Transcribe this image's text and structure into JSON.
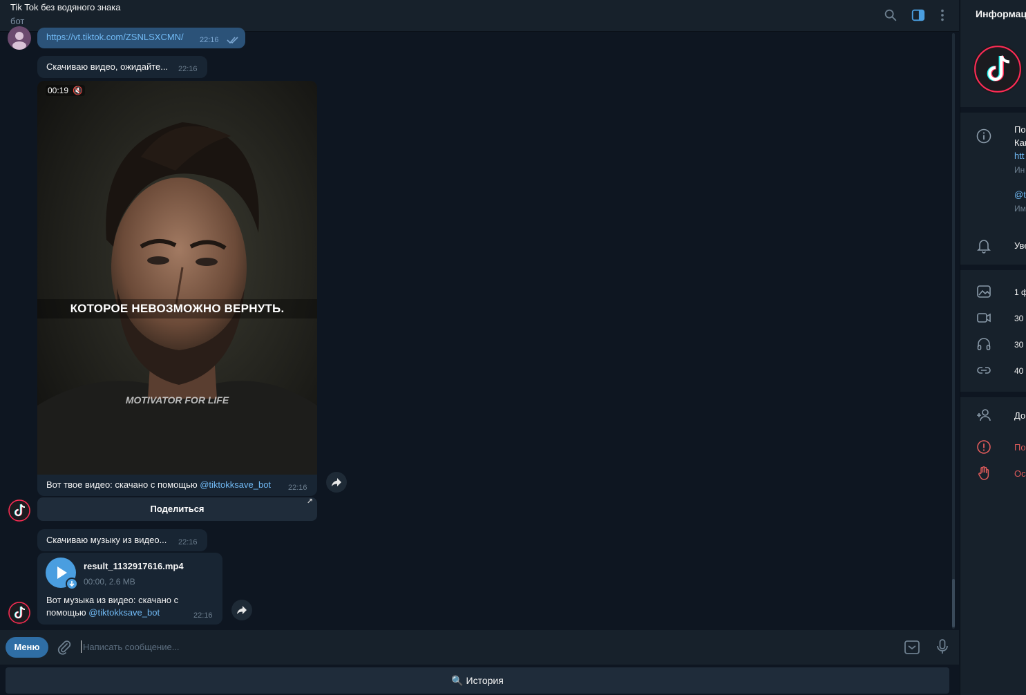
{
  "header": {
    "title": "Tik Tok без водяного знака",
    "subtitle": "бот"
  },
  "messages": {
    "link_msg": {
      "text": "https://vt.tiktok.com/ZSNLSXCMN/",
      "time": "22:16"
    },
    "downloading_video": {
      "text": "Скачиваю видео, ожидайте...",
      "time": "22:16"
    },
    "video": {
      "duration": "00:19",
      "caption_overlay": "КОТОРОЕ НЕВОЗМОЖНО ВЕРНУТЬ.",
      "watermark": "MOTIVATOR FOR LIFE",
      "text_prefix": "Вот твое видео: скачано с помощью ",
      "mention": "@tiktokksave_bot",
      "time": "22:16",
      "share_label": "Поделиться"
    },
    "downloading_music": {
      "text": "Скачиваю музыку из видео...",
      "time": "22:16"
    },
    "audio": {
      "file_name": "result_1132917616.mp4",
      "meta": "00:00, 2.6 MB",
      "line1": "Вот музыка из видео: скачано с",
      "line2_prefix": "помощью ",
      "mention": "@tiktokksave_bot",
      "time": "22:16"
    }
  },
  "composer": {
    "menu_label": "Меню",
    "placeholder": "Написать сообщение..."
  },
  "keyboard": {
    "history_label": "🔍 История"
  },
  "info_panel": {
    "title": "Информац",
    "about_lines": [
      "По",
      "Как",
      "htt",
      "Ин"
    ],
    "username_lines": [
      "@t",
      "Им"
    ],
    "notifications": "Уве",
    "media_counts": [
      "1 ф",
      "30",
      "30",
      "40"
    ],
    "add_label": "До",
    "report_label": "По",
    "stop_label": "Ос"
  },
  "colors": {
    "background": "#0e1621",
    "panel": "#17212b",
    "incoming_bubble": "#182533",
    "outgoing_bubble": "#2b5278",
    "accent": "#4a9ee0",
    "link": "#71baf5",
    "danger": "#e05b5b"
  }
}
